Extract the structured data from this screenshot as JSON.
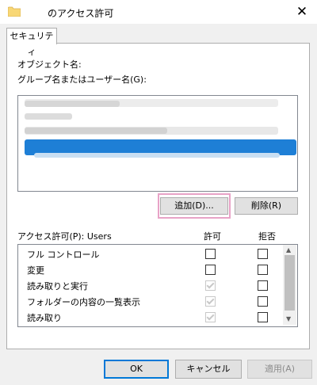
{
  "window": {
    "title": "のアクセス許可",
    "close_symbol": "✕"
  },
  "tab": {
    "label": "セキュリティ"
  },
  "object_name_label": "オブジェクト名:",
  "group_label": "グループ名またはユーザー名(G):",
  "buttons": {
    "add": "追加(D)...",
    "remove": "削除(R)"
  },
  "permissions": {
    "header_label": "アクセス許可(P): Users",
    "allow_header": "許可",
    "deny_header": "拒否",
    "rows": [
      {
        "name": "フル コントロール",
        "allow": false,
        "allow_disabled": false,
        "deny": false
      },
      {
        "name": "変更",
        "allow": false,
        "allow_disabled": false,
        "deny": false
      },
      {
        "name": "読み取りと実行",
        "allow": true,
        "allow_disabled": true,
        "deny": false
      },
      {
        "name": "フォルダーの内容の一覧表示",
        "allow": true,
        "allow_disabled": true,
        "deny": false
      },
      {
        "name": "読み取り",
        "allow": true,
        "allow_disabled": true,
        "deny": false
      }
    ]
  },
  "footer": {
    "ok": "OK",
    "cancel": "キャンセル",
    "apply": "適用(A)"
  },
  "colors": {
    "selection": "#1e7fd6",
    "highlight_border": "#e8a3c7"
  }
}
